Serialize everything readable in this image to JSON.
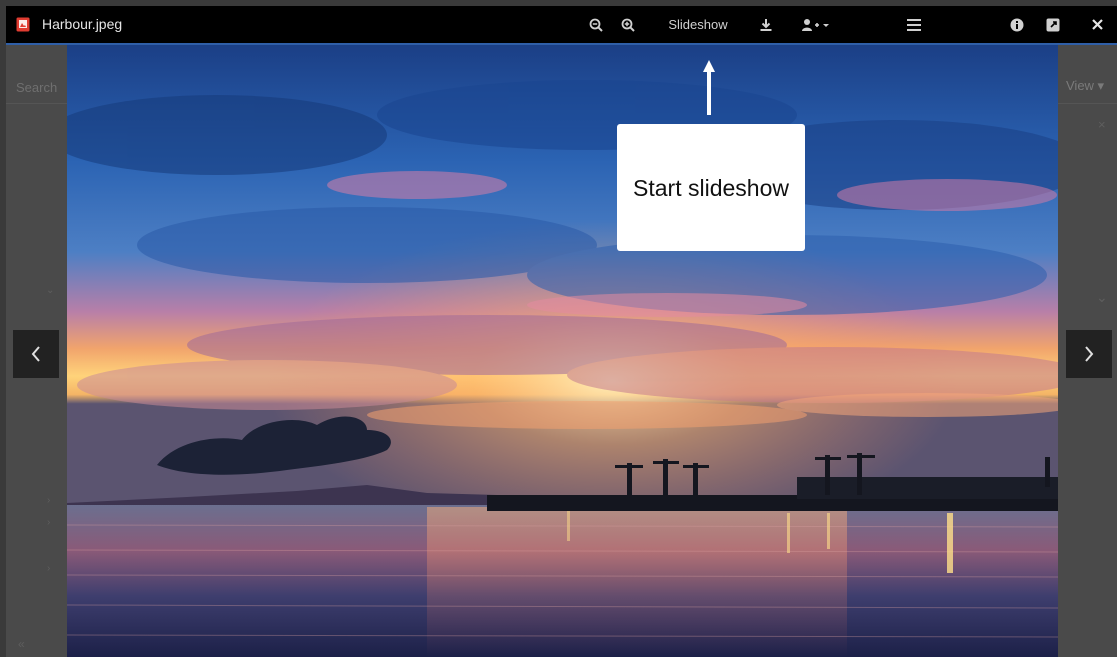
{
  "toolbar": {
    "file_name": "Harbour.jpeg",
    "slideshow_label": "Slideshow",
    "icons": [
      "pdf-file-icon",
      "zoom-out-icon",
      "zoom-in-icon",
      "download-icon",
      "share-user-icon",
      "menu-icon",
      "info-icon",
      "external-link-icon",
      "close-icon"
    ]
  },
  "background": {
    "search_placeholder": "Search",
    "view_label": "View ▾"
  },
  "callout": {
    "text": "Start slideshow"
  },
  "colors": {
    "toolbar_bg": "#000000",
    "accent_line": "#2f5fa8",
    "file_icon": "#e03c31"
  }
}
